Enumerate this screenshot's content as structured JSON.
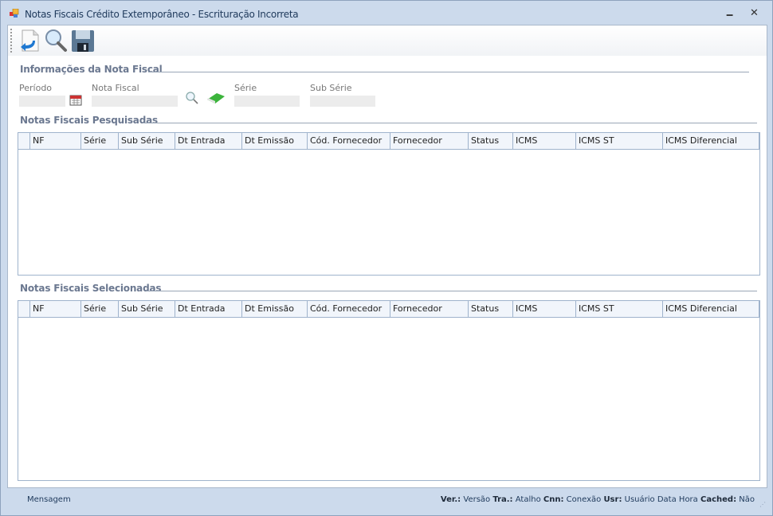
{
  "window": {
    "title": "Notas Fiscais Crédito Extemporâneo - Escrituração Incorreta",
    "minimize": "🗕",
    "close": "✕"
  },
  "toolbar": [
    {
      "name": "new-document-button",
      "icon": "document-arrow-icon"
    },
    {
      "name": "search-button",
      "icon": "magnifier-icon"
    },
    {
      "name": "save-button",
      "icon": "floppy-icon"
    }
  ],
  "info": {
    "title": "Informações da Nota Fiscal",
    "periodo": "Período",
    "nota_fiscal": "Nota Fiscal",
    "serie": "Série",
    "sub_serie": "Sub Série"
  },
  "pesquisadas": {
    "title": "Notas Fiscais Pesquisadas"
  },
  "selecionadas": {
    "title": "Notas Fiscais Selecionadas"
  },
  "columns": [
    "NF",
    "Série",
    "Sub Série",
    "Dt Entrada",
    "Dt Emissão",
    "Cód. Fornecedor",
    "Fornecedor",
    "Status",
    "ICMS",
    "ICMS ST",
    "ICMS Diferencial"
  ],
  "status": {
    "mensagem": "Mensagem",
    "ver_l": "Ver.:",
    "ver": "Versão",
    "tra_l": "Tra.:",
    "tra": "Atalho",
    "cnn_l": "Cnn:",
    "cnn": "Conexão",
    "usr_l": "Usr:",
    "usr": "Usuário",
    "data": "Data",
    "hora": "Hora",
    "cached_l": "Cached:",
    "cached": "Não"
  }
}
